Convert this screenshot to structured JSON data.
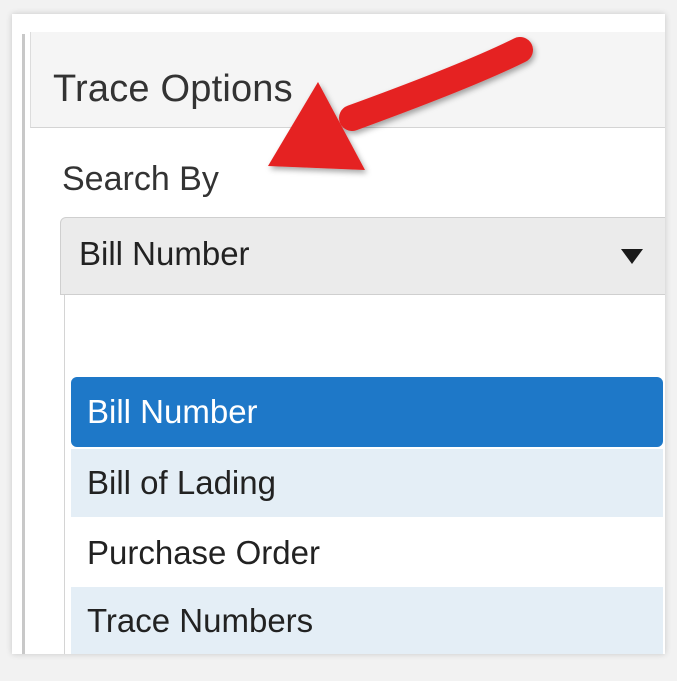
{
  "panel": {
    "title": "Trace Options"
  },
  "search": {
    "label": "Search By",
    "selected_value": "Bill Number"
  },
  "dropdown": {
    "options": [
      {
        "label": "",
        "state": "empty"
      },
      {
        "label": "Bill Number",
        "state": "selected"
      },
      {
        "label": "Bill of Lading",
        "state": "default"
      },
      {
        "label": "Purchase Order",
        "state": "default"
      },
      {
        "label": "Trace Numbers",
        "state": "default"
      }
    ]
  },
  "colors": {
    "selected_option": "#1e78c8",
    "alt_row": "#e4eef6",
    "annotation_arrow": "#e52321"
  },
  "icons": {
    "caret": "caret-down-icon",
    "annotation": "red-arrow-pointer"
  }
}
